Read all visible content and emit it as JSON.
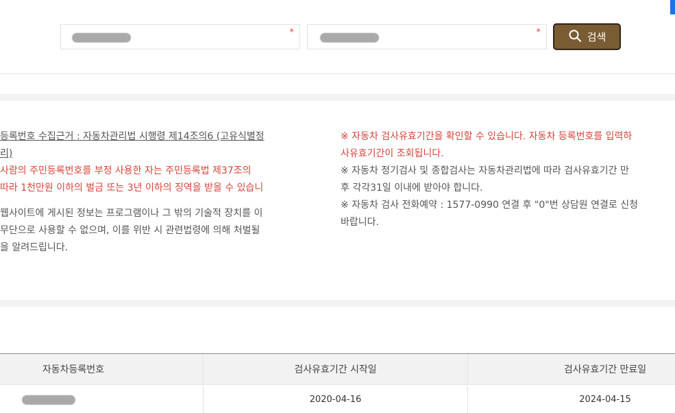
{
  "search": {
    "plate_required_mark": "*",
    "vin_required_mark": "*",
    "button_label": "검색",
    "button_icon": "search-icon"
  },
  "notice": {
    "left": {
      "legal_basis_line1": "등록번호 수집근거 : 자동차관리법 시행령 제14조의6 (고유식별정",
      "legal_basis_line2": "리)",
      "warning_line1": " 사람의 주민등록번호를 부정 사용한 자는 주민등록법 제37조의",
      "warning_line2": " 따라 1천만원 이하의 벌금 또는 3년 이하의 징역을 받을 수 있습니",
      "copyright_line1": "웹사이트에 게시된 정보는 프로그램이나 그 밖의 기술적 장치를 이",
      "copyright_line2": " 무단으로 사용할 수 없으며, 이를 위반 시 관련법령에 의해 처벌될",
      "copyright_line3": "을 알려드립니다."
    },
    "right": {
      "red_line1": "※ 자동차 검사유효기간을 확인할 수 있습니다. 자동차 등록번호를 입력하",
      "red_line2": "사유효기간이 조회됩니다.",
      "line3": "※ 자동차 정기검사 및 종합검사는 자동차관리법에 따라 검사유효기간 만",
      "line4": "후 각각31일 이내에 받아야 합니다.",
      "line5": "※ 자동차 검사 전화예약 : 1577-0990 연결 후 \"0\"번 상담원 연결로 신청",
      "line6": "바랍니다."
    }
  },
  "results": {
    "headers": [
      "자동차등록번호",
      "검사유효기간 시작일",
      "검사유효기간 만료일"
    ],
    "rows": [
      {
        "start": "2020-04-16",
        "end": "2024-04-15"
      }
    ]
  },
  "colors": {
    "button": "#7a5c33",
    "warning": "#d4433b",
    "accent": "#1a73e8"
  }
}
